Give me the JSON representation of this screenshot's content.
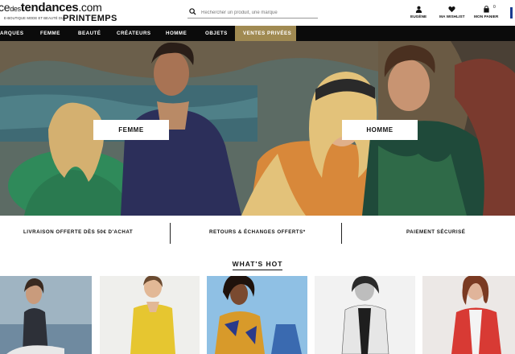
{
  "header": {
    "logo": {
      "prefix": "ce",
      "des": "des",
      "brand": "tendances",
      "domain": ".com",
      "tagline": "E-BOUTIQUE MODE ET BEAUTÉ DU",
      "parent": "PRINTEMPS"
    },
    "search": {
      "placeholder": "Rechercher un produit, une marque",
      "icon": "search-icon"
    },
    "links": [
      {
        "label": "EUGÈNE",
        "icon": "user-icon"
      },
      {
        "label": "MA WISHLIST",
        "icon": "heart-icon"
      },
      {
        "label": "MON PANIER",
        "icon": "bag-icon",
        "badge": "0"
      }
    ]
  },
  "nav": {
    "items": [
      "ARQUES",
      "FEMME",
      "BEAUTÉ",
      "CRÉATEURS",
      "HOMME",
      "OBJETS",
      "VENTES PRIVÉES"
    ],
    "active_color": "#a08a52"
  },
  "hero": {
    "buttons": [
      "FEMME",
      "HOMME"
    ]
  },
  "usp": [
    "LIVRAISON OFFERTE DÈS 50€ D'ACHAT",
    "RETOURS & ÉCHANGES OFFERTS*",
    "PAIEMENT SÉCURISÉ"
  ],
  "whats_hot": {
    "title": "WHAT'S HOT"
  }
}
